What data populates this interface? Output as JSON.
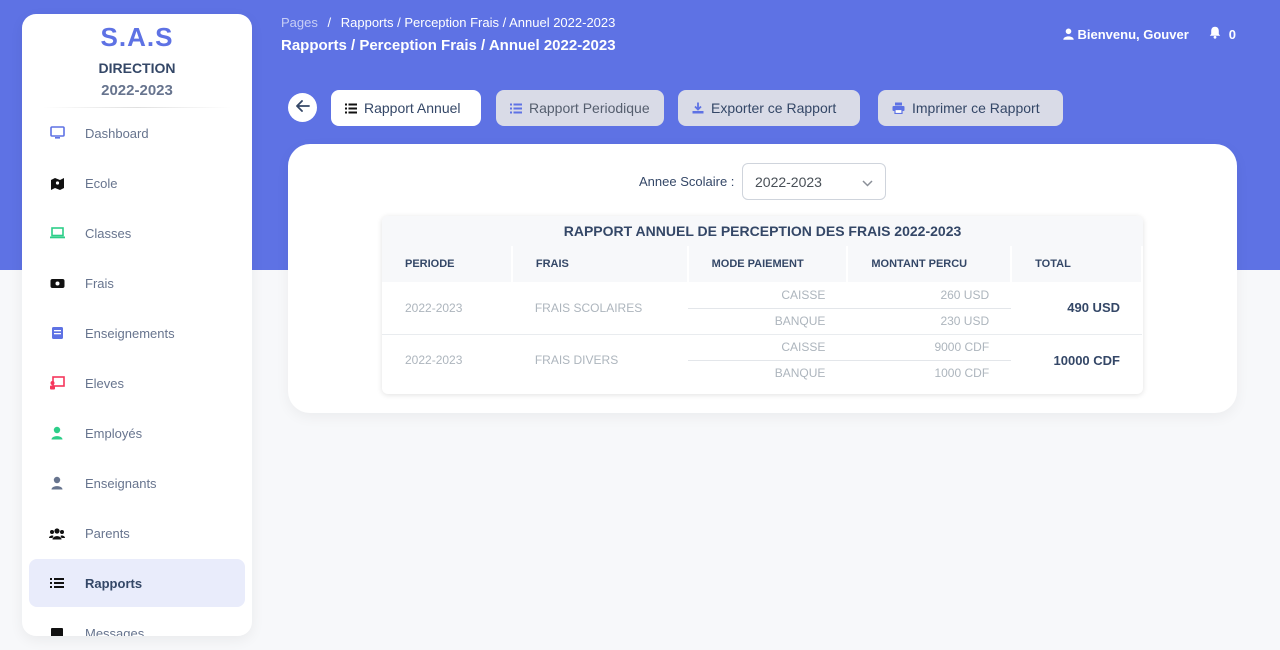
{
  "sidebar": {
    "brand": "S.A.S",
    "subtitle": "DIRECTION",
    "year": "2022-2023",
    "items": [
      {
        "label": "Dashboard",
        "icon": "monitor-icon",
        "color": "#5e72e4"
      },
      {
        "label": "Ecole",
        "icon": "map-icon",
        "color": "#111111"
      },
      {
        "label": "Classes",
        "icon": "laptop-icon",
        "color": "#2dce89"
      },
      {
        "label": "Frais",
        "icon": "money-icon",
        "color": "#111111"
      },
      {
        "label": "Enseignements",
        "icon": "book-icon",
        "color": "#5e72e4"
      },
      {
        "label": "Eleves",
        "icon": "teacher-board-icon",
        "color": "#f5365c"
      },
      {
        "label": "Employés",
        "icon": "user-icon",
        "color": "#2dce89"
      },
      {
        "label": "Enseignants",
        "icon": "user-icon",
        "color": "#67748e"
      },
      {
        "label": "Parents",
        "icon": "users-icon",
        "color": "#111111"
      },
      {
        "label": "Rapports",
        "icon": "list-icon",
        "color": "#111111"
      },
      {
        "label": "Messages",
        "icon": "message-icon",
        "color": "#111111"
      }
    ],
    "active_item": "Rapports"
  },
  "header": {
    "breadcrumb_root": "Pages",
    "breadcrumb_sep": "/",
    "breadcrumb_current": "Rapports / Perception Frais / Annuel 2022-2023",
    "title": "Rapports / Perception Frais / Annuel 2022-2023",
    "user_greeting": "Bienvenu, Gouver",
    "notification_count": "0"
  },
  "toolbar": {
    "annual_label": "Rapport Annuel",
    "periodic_label": "Rapport Periodique",
    "export_label": "Exporter ce Rapport",
    "print_label": "Imprimer ce Rapport"
  },
  "filter": {
    "label": "Annee Scolaire :",
    "selected": "2022-2023"
  },
  "report": {
    "title": "RAPPORT ANNUEL DE PERCEPTION DES FRAIS 2022-2023",
    "columns": [
      "PERIODE",
      "FRAIS",
      "MODE PAIEMENT",
      "MONTANT PERCU",
      "TOTAL"
    ],
    "groups": [
      {
        "periode": "2022-2023",
        "frais": "FRAIS SCOLAIRES",
        "rows": [
          {
            "mode": "CAISSE",
            "montant": "260 USD"
          },
          {
            "mode": "BANQUE",
            "montant": "230 USD"
          }
        ],
        "total": "490 USD"
      },
      {
        "periode": "2022-2023",
        "frais": "FRAIS DIVERS",
        "rows": [
          {
            "mode": "CAISSE",
            "montant": "9000 CDF"
          },
          {
            "mode": "BANQUE",
            "montant": "1000 CDF"
          }
        ],
        "total": "10000 CDF"
      }
    ]
  },
  "colors": {
    "primary": "#5e72e4",
    "background": "#f7f8fa",
    "text": "#344767"
  }
}
